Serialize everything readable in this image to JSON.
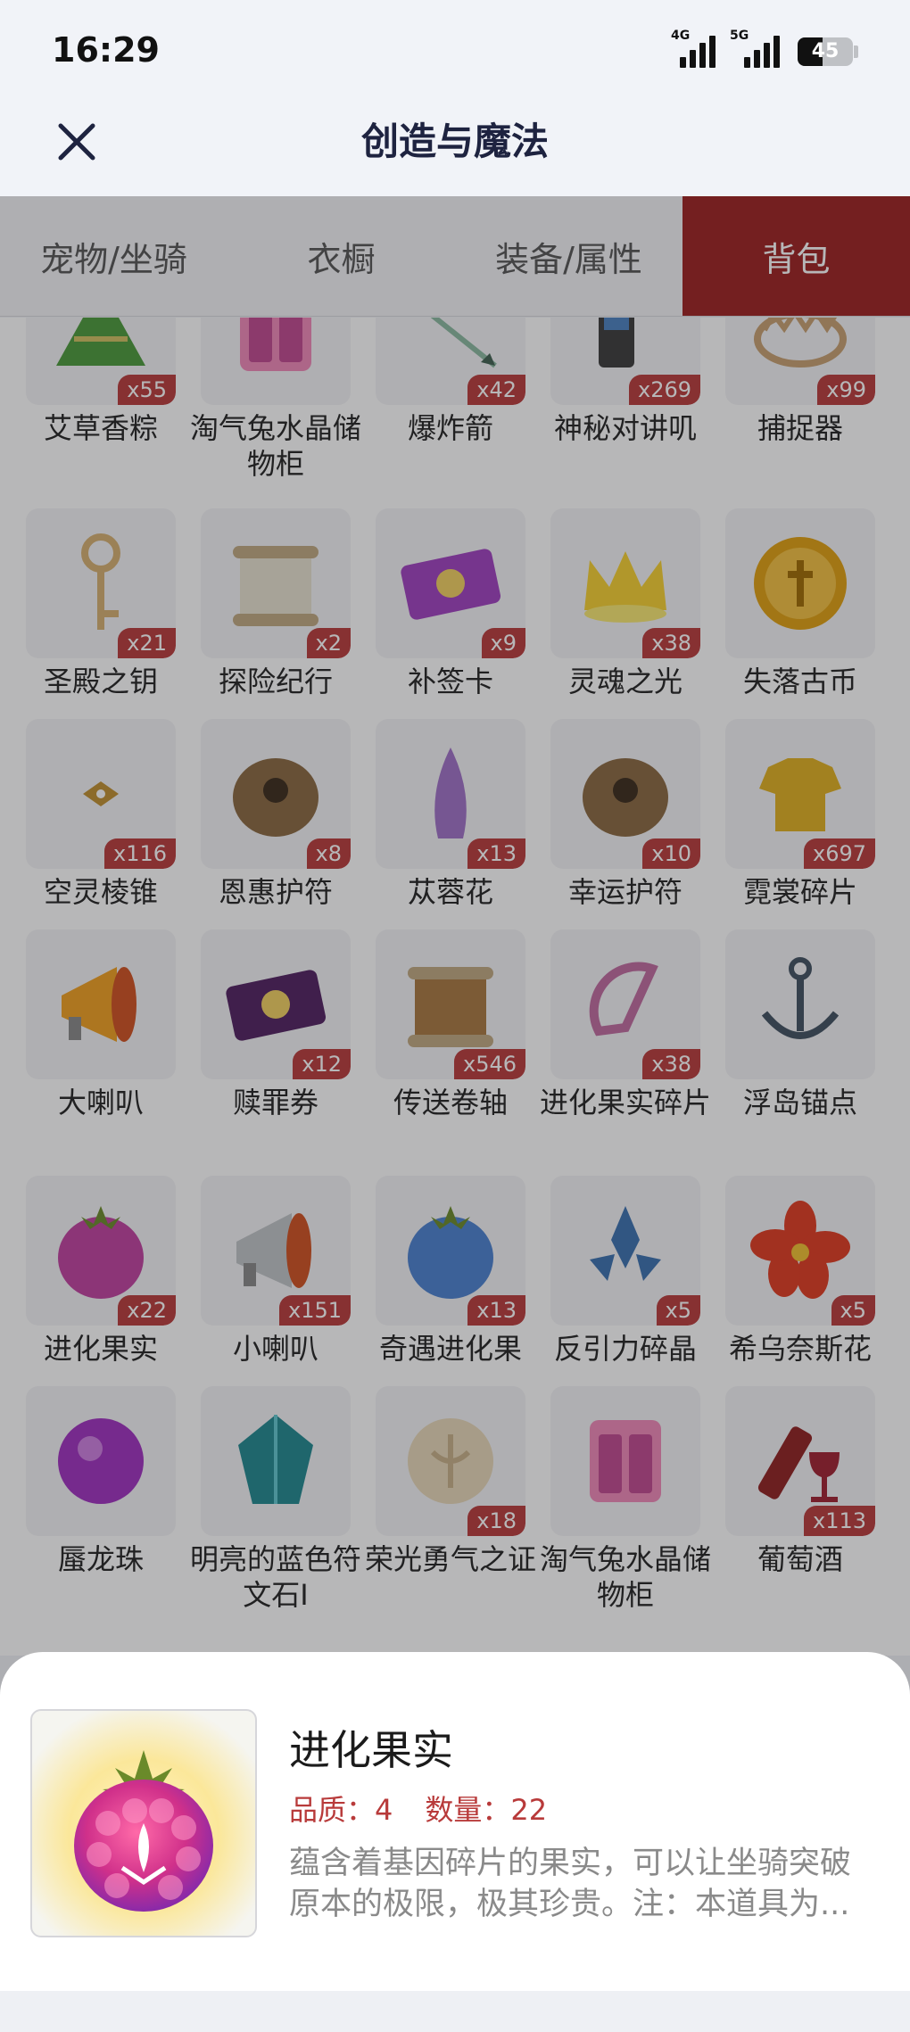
{
  "status": {
    "time": "16:29",
    "net1": "4G",
    "net2": "5G",
    "battery": "45",
    "battery_level": 0.45
  },
  "header": {
    "title": "创造与魔法",
    "close_icon": "close-icon"
  },
  "tabs": [
    {
      "label": "宠物/坐骑",
      "active": false
    },
    {
      "label": "衣橱",
      "active": false
    },
    {
      "label": "装备/属性",
      "active": false
    },
    {
      "label": "背包",
      "active": true
    }
  ],
  "items": [
    {
      "name": "艾草香粽",
      "count": "x55",
      "icon": "zongzi-icon",
      "color": "#4b9a3a"
    },
    {
      "name": "淘气兔水晶储物柜",
      "count": "",
      "icon": "cabinet-icon",
      "color": "#f088b8"
    },
    {
      "name": "爆炸箭",
      "count": "x42",
      "icon": "arrow-icon",
      "color": "#8ab8a0"
    },
    {
      "name": "神秘对讲叽",
      "count": "x269",
      "icon": "walkie-talkie-icon",
      "color": "#3a3a3a"
    },
    {
      "name": "捕捉器",
      "count": "x99",
      "icon": "trap-icon",
      "color": "#c8a070"
    },
    {
      "name": "圣殿之钥",
      "count": "x21",
      "icon": "key-icon",
      "color": "#d6b070"
    },
    {
      "name": "探险纪行",
      "count": "x2",
      "icon": "scroll-icon",
      "color": "#e8e2d0"
    },
    {
      "name": "补签卡",
      "count": "x9",
      "icon": "ticket-icon",
      "color": "#a040c0"
    },
    {
      "name": "灵魂之光",
      "count": "x38",
      "icon": "crown-icon",
      "color": "#f6d030"
    },
    {
      "name": "失落古币",
      "count": "",
      "icon": "coin-icon",
      "color": "#e0a010"
    },
    {
      "name": "空灵棱锥",
      "count": "x116",
      "icon": "pyramid-icon",
      "color": "#c09030"
    },
    {
      "name": "恩惠护符",
      "count": "x8",
      "icon": "amulet-icon",
      "color": "#8a6840"
    },
    {
      "name": "苁蓉花",
      "count": "x13",
      "icon": "flower-spike-icon",
      "color": "#a070c8"
    },
    {
      "name": "幸运护符",
      "count": "x10",
      "icon": "amulet-icon",
      "color": "#8a6840"
    },
    {
      "name": "霓裳碎片",
      "count": "x697",
      "icon": "shirt-icon",
      "color": "#e0b020"
    },
    {
      "name": "大喇叭",
      "count": "",
      "icon": "megaphone-icon",
      "color": "#f0a020"
    },
    {
      "name": "赎罪券",
      "count": "x12",
      "icon": "voucher-icon",
      "color": "#502060"
    },
    {
      "name": "传送卷轴",
      "count": "x546",
      "icon": "scroll-icon",
      "color": "#a87840"
    },
    {
      "name": "进化果实碎片",
      "count": "x38",
      "icon": "fruit-shard-icon",
      "color": "#c06aa0"
    },
    {
      "name": "浮岛锚点",
      "count": "",
      "icon": "anchor-icon",
      "color": "#405060"
    },
    {
      "name": "进化果实",
      "count": "x22",
      "icon": "raspberry-icon",
      "color": "#c040a0"
    },
    {
      "name": "小喇叭",
      "count": "x151",
      "icon": "megaphone-icon",
      "color": "#c0c4c8"
    },
    {
      "name": "奇遇进化果",
      "count": "x13",
      "icon": "berry-icon",
      "color": "#4a80d0"
    },
    {
      "name": "反引力碎晶",
      "count": "x5",
      "icon": "crystal-icon",
      "color": "#3a70b0"
    },
    {
      "name": "希乌奈斯花",
      "count": "x5",
      "icon": "flower-icon",
      "color": "#e03a20"
    },
    {
      "name": "蜃龙珠",
      "count": "",
      "icon": "orb-icon",
      "color": "#a030c0"
    },
    {
      "name": "明亮的蓝色符文石I",
      "count": "",
      "icon": "gem-icon",
      "color": "#208890"
    },
    {
      "name": "荣光勇气之证",
      "count": "x18",
      "icon": "emblem-icon",
      "color": "#e8d8b8"
    },
    {
      "name": "淘气兔水晶储物柜",
      "count": "",
      "icon": "cabinet-icon",
      "color": "#f088b8"
    },
    {
      "name": "葡萄酒",
      "count": "x113",
      "icon": "wine-icon",
      "color": "#902020"
    }
  ],
  "detail": {
    "name": "进化果实",
    "quality_label": "品质：",
    "quality": "4",
    "quantity_label": "数量：",
    "quantity": "22",
    "description": "蕴含着基因碎片的果实，可以让坐骑突破原本的极限，极其珍贵。注：本道具为...",
    "icon": "raspberry-icon"
  }
}
